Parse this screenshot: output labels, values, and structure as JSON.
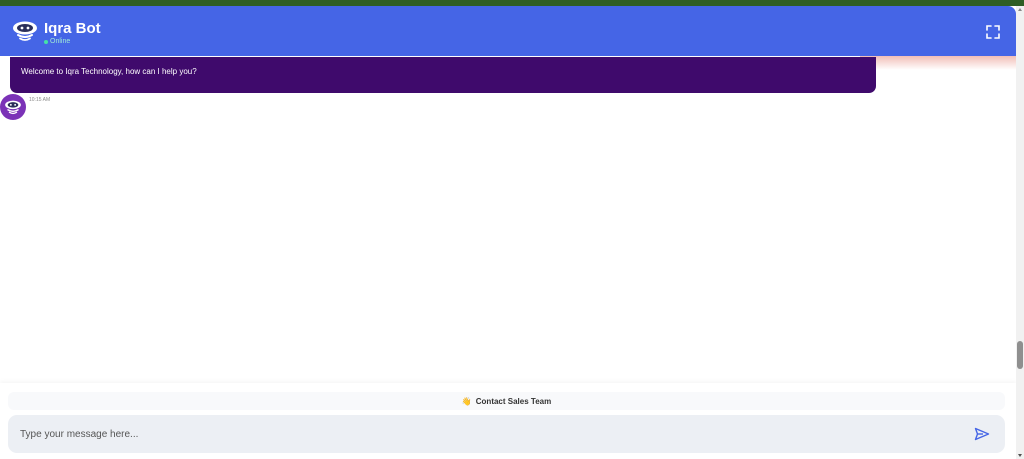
{
  "header": {
    "bot_name": "Iqra Bot",
    "status": "Online",
    "logo_icon": "robot-icon",
    "expand_icon": "fullscreen-icon",
    "background_color": "#4565e6"
  },
  "messages": [
    {
      "sender": "bot",
      "text": "Welcome to Iqra Technology, how can I help you?",
      "time": "10:15 AM",
      "bubble_color": "#3f0a6c"
    }
  ],
  "footer": {
    "contact_emoji": "👋",
    "contact_label": "Contact Sales Team",
    "input_placeholder": "Type your message here...",
    "send_icon": "send-icon"
  }
}
